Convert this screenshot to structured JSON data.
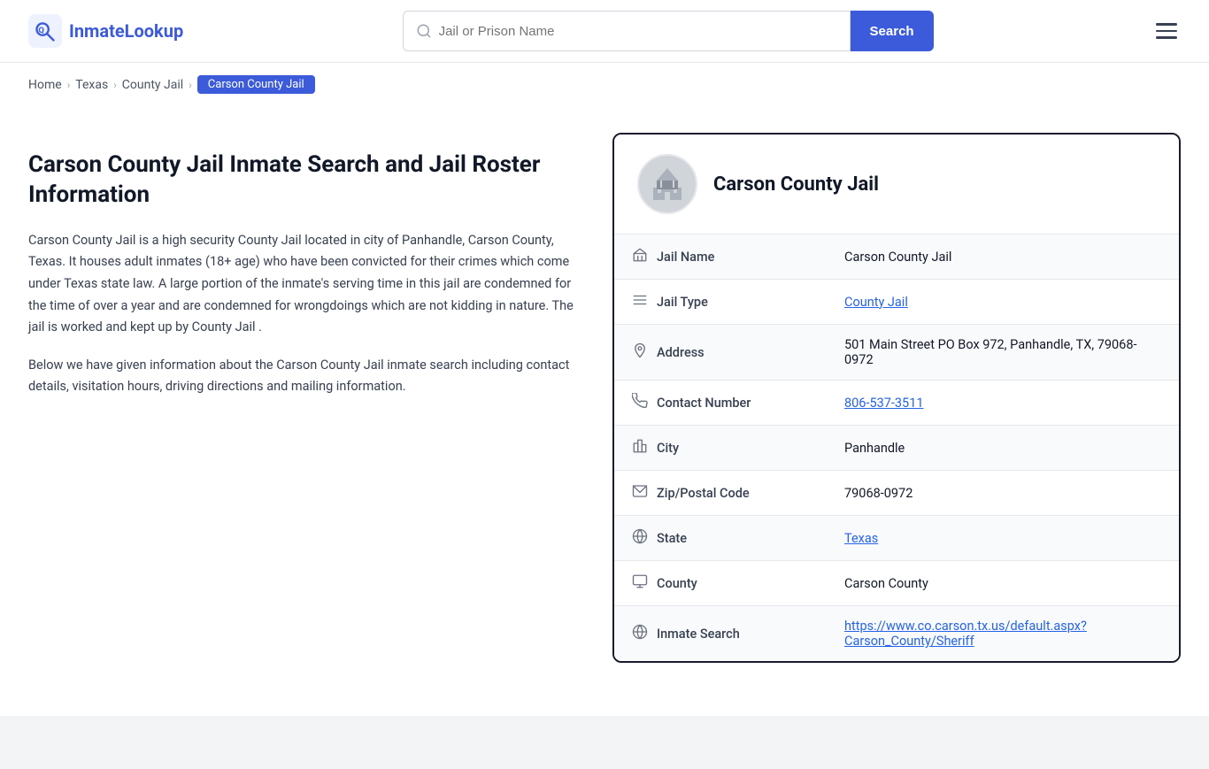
{
  "logo": {
    "text_prefix": "Inmate",
    "text_suffix": "Lookup"
  },
  "search": {
    "placeholder": "Jail or Prison Name",
    "button_label": "Search"
  },
  "breadcrumb": {
    "items": [
      "Home",
      "Texas",
      "County Jail",
      "Carson County Jail"
    ]
  },
  "left": {
    "title": "Carson County Jail Inmate Search and Jail Roster Information",
    "description1": "Carson County Jail is a high security County Jail located in city of Panhandle, Carson County, Texas. It houses adult inmates (18+ age) who have been convicted for their crimes which come under Texas state law. A large portion of the inmate's serving time in this jail are condemned for the time of over a year and are condemned for wrongdoings which are not kidding in nature. The jail is worked and kept up by County Jail .",
    "description2": "Below we have given information about the Carson County Jail inmate search including contact details, visitation hours, driving directions and mailing information."
  },
  "card": {
    "title": "Carson County Jail",
    "fields": [
      {
        "id": "jail-name",
        "icon": "🏛",
        "label": "Jail Name",
        "value": "Carson County Jail",
        "link": false,
        "shaded": true
      },
      {
        "id": "jail-type",
        "icon": "≡",
        "label": "Jail Type",
        "value": "County Jail",
        "link": true,
        "href": "#",
        "shaded": false
      },
      {
        "id": "address",
        "icon": "📍",
        "label": "Address",
        "value": "501 Main Street PO Box 972, Panhandle, TX, 79068-0972",
        "link": false,
        "shaded": true
      },
      {
        "id": "contact",
        "icon": "📞",
        "label": "Contact Number",
        "value": "806-537-3511",
        "link": true,
        "href": "tel:806-537-3511",
        "shaded": false
      },
      {
        "id": "city",
        "icon": "🏙",
        "label": "City",
        "value": "Panhandle",
        "link": false,
        "shaded": true
      },
      {
        "id": "zip",
        "icon": "✉",
        "label": "Zip/Postal Code",
        "value": "79068-0972",
        "link": false,
        "shaded": false
      },
      {
        "id": "state",
        "icon": "🌐",
        "label": "State",
        "value": "Texas",
        "link": true,
        "href": "#",
        "shaded": true
      },
      {
        "id": "county",
        "icon": "🖥",
        "label": "County",
        "value": "Carson County",
        "link": false,
        "shaded": false
      },
      {
        "id": "inmate-search",
        "icon": "🌐",
        "label": "Inmate Search",
        "value": "https://www.co.carson.tx.us/default.aspx?Carson_County/Sheriff",
        "link": true,
        "href": "https://www.co.carson.tx.us/default.aspx?Carson_County/Sheriff",
        "shaded": true
      }
    ]
  },
  "footer": {}
}
